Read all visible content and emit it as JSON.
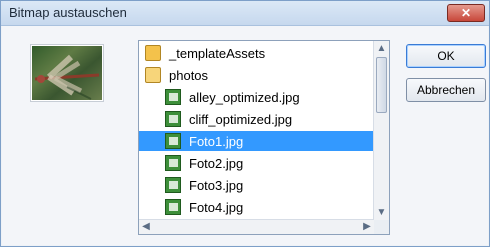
{
  "window": {
    "title": "Bitmap austauschen",
    "close_label": "✕"
  },
  "preview": {
    "alt": "Libelle"
  },
  "files": [
    {
      "name": "_templateAssets",
      "type": "folder",
      "indent": 0,
      "selected": false
    },
    {
      "name": "photos",
      "type": "folder-open",
      "indent": 0,
      "selected": false
    },
    {
      "name": "alley_optimized.jpg",
      "type": "image",
      "indent": 1,
      "selected": false
    },
    {
      "name": "cliff_optimized.jpg",
      "type": "image",
      "indent": 1,
      "selected": false
    },
    {
      "name": "Foto1.jpg",
      "type": "image",
      "indent": 1,
      "selected": true
    },
    {
      "name": "Foto2.jpg",
      "type": "image",
      "indent": 1,
      "selected": false
    },
    {
      "name": "Foto3.jpg",
      "type": "image",
      "indent": 1,
      "selected": false
    },
    {
      "name": "Foto4.jpg",
      "type": "image",
      "indent": 1,
      "selected": false
    }
  ],
  "buttons": {
    "ok": "OK",
    "cancel": "Abbrechen"
  },
  "scroll": {
    "up": "▲",
    "down": "▼",
    "left": "◀",
    "right": "▶"
  }
}
